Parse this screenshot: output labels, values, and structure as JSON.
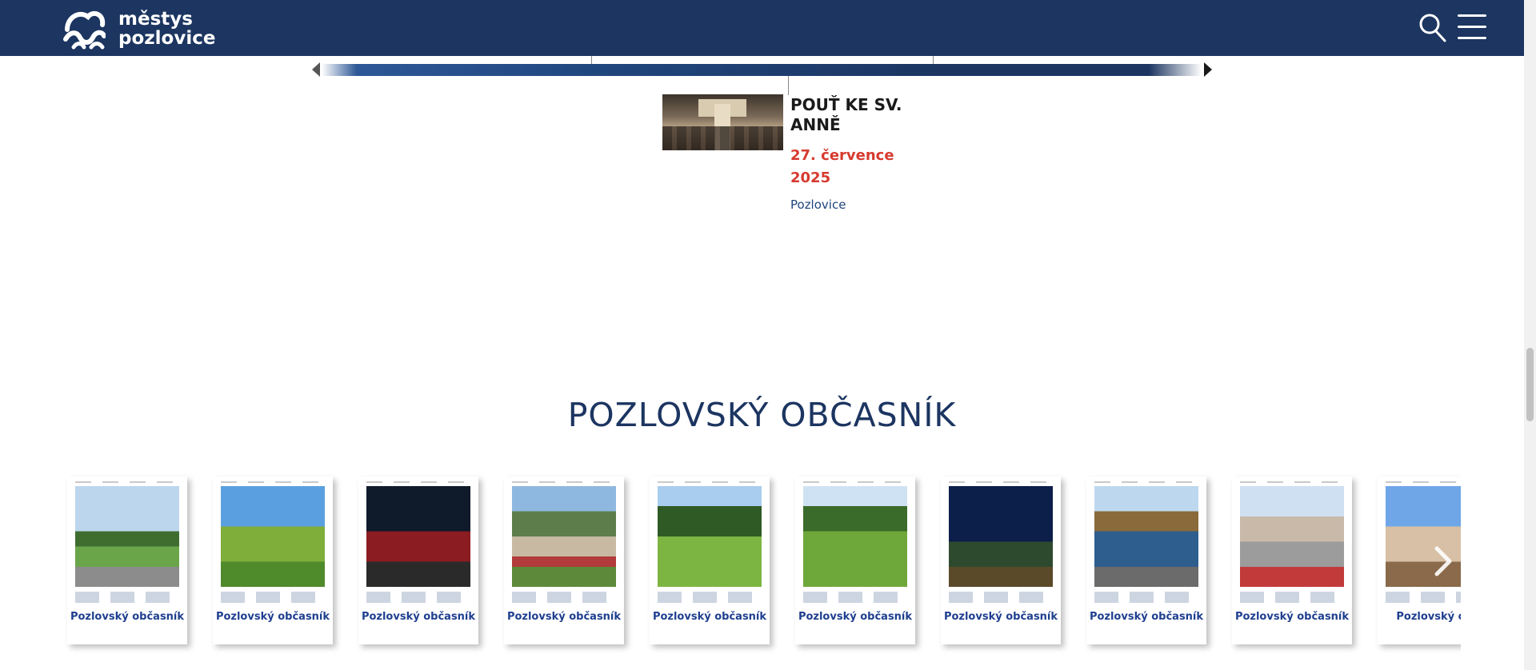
{
  "header": {
    "logo_line1": "městys",
    "logo_line2": "pozlovice",
    "search_icon": "search-icon",
    "menu_icon": "hamburger-menu-icon",
    "bg_color": "#1c3561"
  },
  "event": {
    "title": "POUŤ KE SV. ANNĚ",
    "date": "27. července 2025",
    "place": "Pozlovice",
    "date_color": "#d63a2f"
  },
  "section": {
    "title": "POZLOVSKÝ OBČASNÍK"
  },
  "newsletters": [
    {
      "title": "Pozlovský občasník"
    },
    {
      "title": "Pozlovský občasník"
    },
    {
      "title": "Pozlovský občasník"
    },
    {
      "title": "Pozlovský občasník"
    },
    {
      "title": "Pozlovský občasník"
    },
    {
      "title": "Pozlovský občasník"
    },
    {
      "title": "Pozlovský občasník"
    },
    {
      "title": "Pozlovský občasník"
    },
    {
      "title": "Pozlovský občasník"
    },
    {
      "title": "Pozlovský obč"
    }
  ],
  "carousel": {
    "next_icon": "chevron-right-icon"
  }
}
